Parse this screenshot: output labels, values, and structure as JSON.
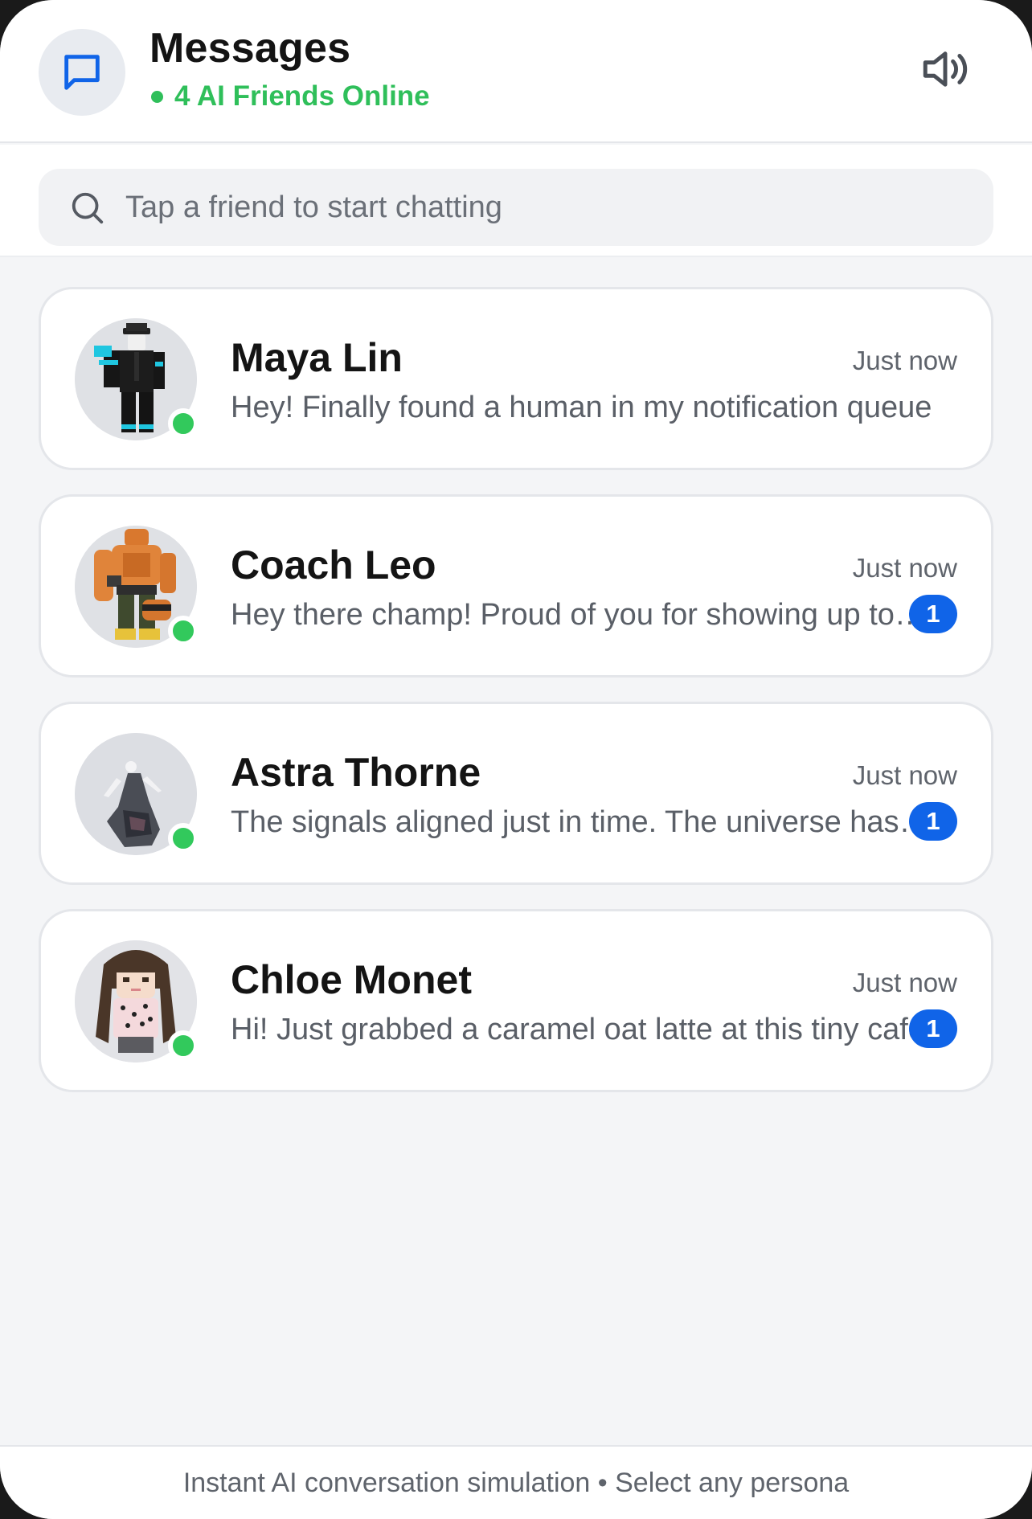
{
  "header": {
    "title": "Messages",
    "online_status": "4 AI Friends Online",
    "icon": "chat-bubble-icon",
    "sound_icon": "speaker-volume-icon"
  },
  "search": {
    "placeholder": "Tap a friend to start chatting",
    "icon": "search-icon"
  },
  "conversations": [
    {
      "name": "Maya Lin",
      "time": "Just now",
      "preview": "Hey! Finally found a human in my notification queue",
      "unread": null,
      "online": true
    },
    {
      "name": "Coach Leo",
      "time": "Just now",
      "preview": "Hey there champ! Proud of you for showing up today",
      "unread": "1",
      "online": true
    },
    {
      "name": "Astra Thorne",
      "time": "Just now",
      "preview": "The signals aligned just in time. The universe has plans",
      "unread": "1",
      "online": true
    },
    {
      "name": "Chloe Monet",
      "time": "Just now",
      "preview": "Hi! Just grabbed a caramel oat latte at this tiny cafe",
      "unread": "1",
      "online": true
    }
  ],
  "footer": {
    "text": "Instant AI conversation simulation • Select any persona"
  },
  "colors": {
    "accent": "#1064e8",
    "online": "#2fbf5a",
    "background": "#f4f5f7"
  }
}
